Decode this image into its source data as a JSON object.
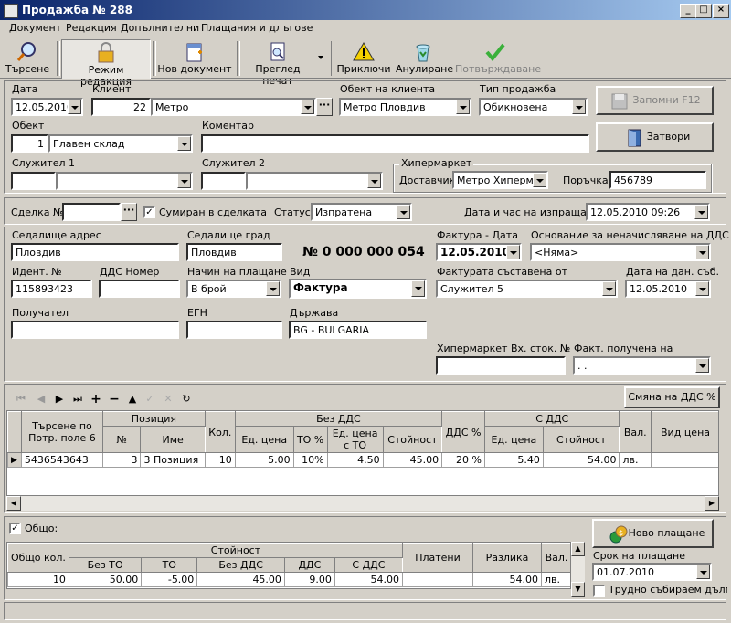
{
  "window": {
    "title": "Продажба № 288"
  },
  "menu": [
    "Документ",
    "Редакция",
    "Допълнителни",
    "Плащания и длъгове"
  ],
  "toolbar": {
    "search": "Търсене",
    "edit_mode": "Режим редакция",
    "new_doc": "Нов документ",
    "print_preview": "Преглед печат",
    "finish": "Приключи",
    "cancel": "Анулиране",
    "confirm": "Потвърждаване"
  },
  "header": {
    "date_label": "Дата",
    "date": "12.05.2010",
    "client_label": "Клиент",
    "client_id": "22",
    "client_name": "Метро",
    "client_object_label": "Обект на клиента",
    "client_object": "Метро Пловдив",
    "sale_type_label": "Тип продажба",
    "sale_type": "Обикновена",
    "save_button": "Запомни  F12",
    "object_label": "Обект",
    "object_id": "1",
    "object_name": "Главен склад",
    "comment_label": "Коментар",
    "comment": "",
    "close_button": "Затвори",
    "employee1_label": "Служител 1",
    "employee2_label": "Служител 2",
    "hypermarket_label": "Хипермаркет",
    "supplier_label": "Доставчик",
    "supplier": "Метро Хипермар",
    "order_label": "Поръчка",
    "order": "456789"
  },
  "deal": {
    "deal_label": "Сделка №",
    "deal_value": "",
    "summed_label": "Сумиран в сделката",
    "summed_checked": true,
    "status_label": "Статус",
    "status": "Изпратена",
    "sent_label": "Дата и час на изпращане",
    "sent": "12.05.2010 09:26"
  },
  "invoice": {
    "hq_address_label": "Седалище адрес",
    "hq_address": "Пловдив",
    "hq_city_label": "Седалище град",
    "hq_city": "Пловдив",
    "number": "№ 0 000 000 054",
    "inv_date_label": "Фактура - Дата",
    "inv_date": "12.05.2010",
    "no_vat_label": "Основание за неначисляване на ДДС",
    "no_vat": "<Няма>",
    "ident_label": "Идент. №",
    "ident": "115893423",
    "vat_no_label": "ДДС Номер",
    "vat_no": "",
    "payment_label": "Начин на плащане",
    "payment": "В брой",
    "type_label": "Вид",
    "type": "Фактура",
    "composed_by_label": "Фактурата съставена от",
    "composed_by": "Служител 5",
    "tax_date_label": "Дата на дан. съб.",
    "tax_date": "12.05.2010",
    "recipient_label": "Получател",
    "recipient": "",
    "egn_label": "ЕГН",
    "egn": "",
    "country_label": "Държава",
    "country": "BG - BULGARIA",
    "hyper_in_label": "Хипермаркет Вх. сток. №",
    "hyper_in": "",
    "received_label": "Факт. получена на",
    "received": ". ."
  },
  "items": {
    "vat_change_button": "Смяна на ДДС %",
    "headers": {
      "search_pos": "Търсене по Потр. поле 6",
      "position": "Позиция",
      "no": "№",
      "name": "Име",
      "qty": "Кол.",
      "without_vat": "Без ДДС",
      "unit_price": "Ед. цена",
      "to_pct": "ТО %",
      "unit_price_to": "Ед. цена с ТО",
      "value": "Стойност",
      "vat_pct": "ДДС %",
      "with_vat": "С ДДС",
      "unit_price2": "Ед. цена",
      "value2": "Стойност",
      "currency": "Вал.",
      "price_type": "Вид цена"
    },
    "rows": [
      {
        "code": "5436543643",
        "no": "3",
        "name": "3 Позиция",
        "qty": "10",
        "unit_price": "5.00",
        "to_pct": "10%",
        "unit_price_to": "4.50",
        "value": "45.00",
        "vat_pct": "20 %",
        "unit_price2": "5.40",
        "value2": "54.00",
        "currency": "лв.",
        "price_type": ""
      }
    ]
  },
  "totals": {
    "total_label": "Общо:",
    "total_checked": true,
    "headers": {
      "total_qty": "Общо кол.",
      "value": "Стойност",
      "without_to": "Без ТО",
      "to": "ТО",
      "without_vat": "Без ДДС",
      "vat": "ДДС",
      "with_vat": "С ДДС",
      "paid": "Платени",
      "diff": "Разлика",
      "currency": "Вал."
    },
    "row": {
      "total_qty": "10",
      "without_to": "50.00",
      "to": "-5.00",
      "without_vat": "45.00",
      "vat": "9.00",
      "with_vat": "54.00",
      "paid": "",
      "diff": "54.00",
      "currency": "лв."
    },
    "new_payment_button": "Ново плащане",
    "due_label": "Срок на плащане",
    "due": "01.07.2010",
    "hard_debt_label": "Трудно събираем дълг"
  },
  "colors": {
    "titlebar": "#0a246a",
    "face": "#d4d0c8"
  }
}
